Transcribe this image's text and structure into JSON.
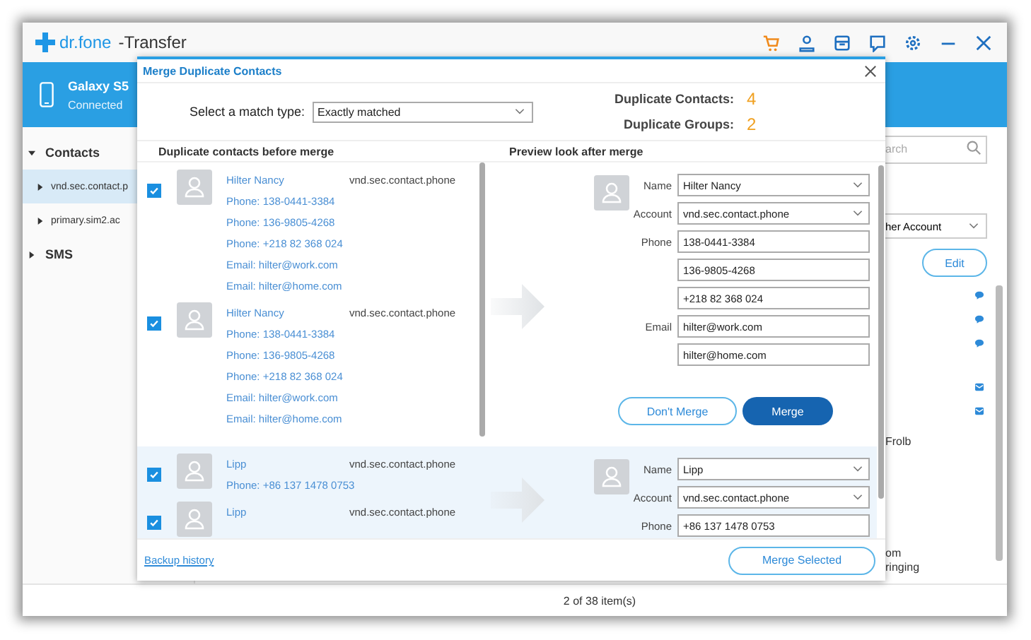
{
  "app": {
    "logo": "dr.fone",
    "title": "-Transfer"
  },
  "device": {
    "name": "Galaxy S5",
    "status": "Connected"
  },
  "sidebar": {
    "items": [
      {
        "label": "Contacts",
        "expanded": true,
        "children": [
          {
            "label": "vnd.sec.contact.p",
            "selected": true
          },
          {
            "label": "primary.sim2.ac",
            "selected": false
          }
        ]
      },
      {
        "label": "SMS",
        "expanded": false
      }
    ]
  },
  "background_panel": {
    "search_placeholder": "arch",
    "account_select": "her Account",
    "edit_button": "Edit",
    "texts": [
      "Frolb",
      "om",
      "ringing"
    ],
    "footer": "2 of 38 item(s)"
  },
  "dialog": {
    "title": "Merge Duplicate Contacts",
    "match_label": "Select a match type:",
    "match_value": "Exactly matched",
    "stats": [
      {
        "label": "Duplicate Contacts:",
        "value": "4"
      },
      {
        "label": "Duplicate Groups:",
        "value": "2"
      }
    ],
    "left_heading": "Duplicate contacts before merge",
    "right_heading": "Preview look after merge",
    "groups": [
      {
        "selected": false,
        "contacts": [
          {
            "checked": true,
            "name": "Hilter  Nancy",
            "account": "vnd.sec.contact.phone",
            "details": [
              "Phone: 138-0441-3384",
              "Phone: 136-9805-4268",
              "Phone: +218 82 368 024",
              "Email: hilter@work.com",
              "Email: hilter@home.com"
            ]
          },
          {
            "checked": true,
            "name": "Hilter  Nancy",
            "account": "vnd.sec.contact.phone",
            "details": [
              "Phone: 138-0441-3384",
              "Phone: 136-9805-4268",
              "Phone: +218 82 368 024",
              "Email: hilter@work.com",
              "Email: hilter@home.com"
            ]
          }
        ],
        "fields": [
          {
            "label": "Name",
            "kind": "select",
            "value": "Hilter Nancy"
          },
          {
            "label": "Account",
            "kind": "select",
            "value": "vnd.sec.contact.phone"
          },
          {
            "label": "Phone",
            "kind": "text",
            "value": "138-0441-3384"
          },
          {
            "kind": "text",
            "value": "136-9805-4268"
          },
          {
            "kind": "text",
            "value": "+218 82 368 024"
          },
          {
            "label": "Email",
            "kind": "text",
            "value": "hilter@work.com"
          },
          {
            "kind": "text",
            "value": "hilter@home.com"
          }
        ],
        "actions": [
          {
            "label": "Don't Merge",
            "kind": "outline"
          },
          {
            "label": "Merge",
            "kind": "primary"
          }
        ]
      },
      {
        "selected": true,
        "contacts": [
          {
            "checked": true,
            "name": "Lipp",
            "account": "vnd.sec.contact.phone",
            "details": [
              "Phone: +86 137 1478 0753"
            ]
          },
          {
            "checked": true,
            "name": "Lipp",
            "account": "vnd.sec.contact.phone"
          }
        ],
        "fields": [
          {
            "label": "Name",
            "kind": "select",
            "value": "Lipp"
          },
          {
            "label": "Account",
            "kind": "select",
            "value": "vnd.sec.contact.phone"
          },
          {
            "label": "Phone",
            "kind": "text",
            "value": "+86 137 1478 0753"
          }
        ]
      }
    ],
    "footer_link": "Backup history",
    "footer_button": "Merge Selected"
  }
}
